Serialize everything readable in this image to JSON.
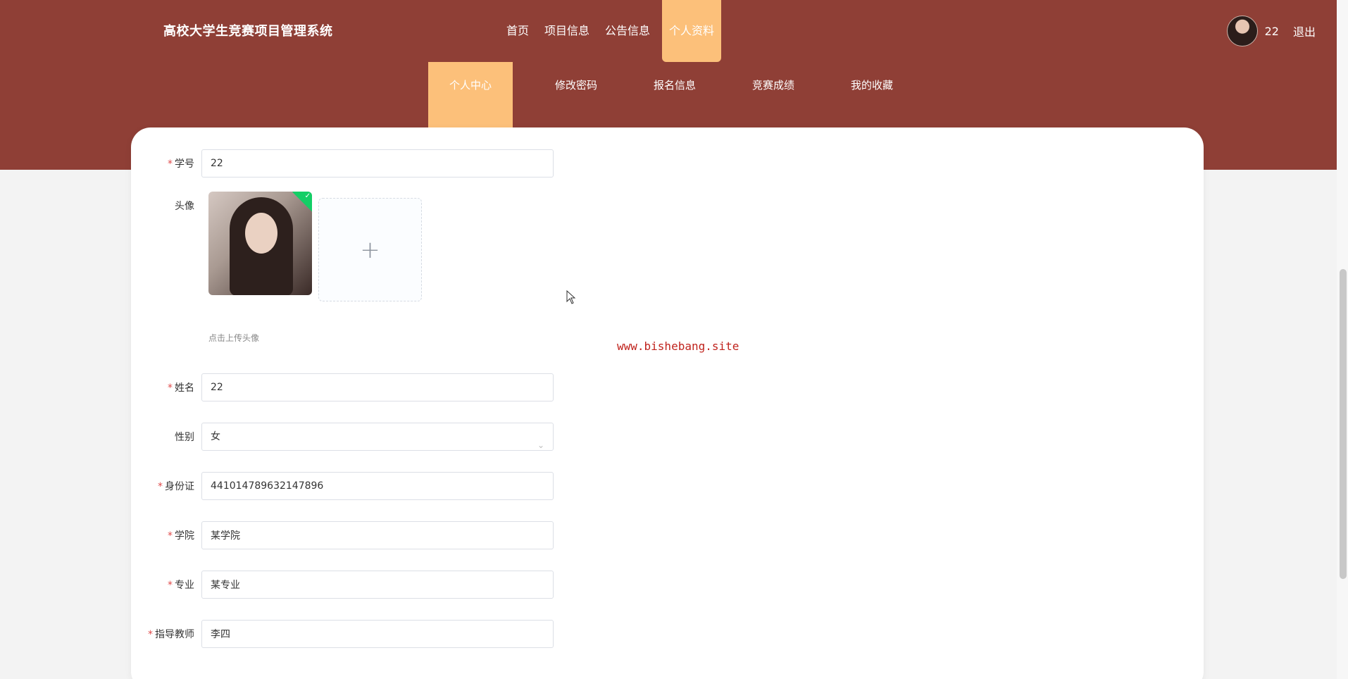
{
  "header": {
    "site_title": "高校大学生竞赛项目管理系统",
    "nav": [
      "首页",
      "项目信息",
      "公告信息",
      "个人资料"
    ],
    "username": "22",
    "logout": "退出"
  },
  "subnav": [
    "个人中心",
    "修改密码",
    "报名信息",
    "竞赛成绩",
    "我的收藏"
  ],
  "form": {
    "student_id": {
      "label": "学号",
      "value": "22"
    },
    "avatar": {
      "label": "头像",
      "tip": "点击上传头像",
      "add_icon": "+"
    },
    "name": {
      "label": "姓名",
      "value": "22"
    },
    "gender": {
      "label": "性别",
      "value": "女"
    },
    "id_card": {
      "label": "身份证",
      "value": "441014789632147896"
    },
    "college": {
      "label": "学院",
      "value": "某学院"
    },
    "major": {
      "label": "专业",
      "value": "某专业"
    },
    "advisor": {
      "label": "指导教师",
      "value": "李四"
    }
  },
  "watermark": "www.bishebang.site",
  "colors": {
    "header_bg": "#8f3f36",
    "active_tab": "#fcc07a",
    "required": "#e04b4b"
  }
}
